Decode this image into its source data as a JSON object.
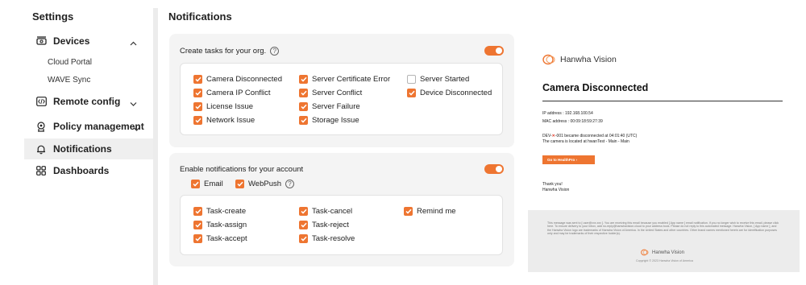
{
  "sidebar": {
    "title": "Settings",
    "devices": {
      "label": "Devices",
      "icon": "router-icon"
    },
    "devices_sub": [
      "Cloud Portal",
      "WAVE Sync"
    ],
    "remote_config": {
      "label": "Remote config",
      "icon": "code-icon"
    },
    "policy": {
      "label": "Policy management",
      "icon": "policy-icon"
    },
    "notifications": {
      "label": "Notifications",
      "icon": "bell-icon"
    },
    "dashboards": {
      "label": "Dashboards",
      "icon": "grid-icon"
    }
  },
  "main": {
    "title": "Notifications",
    "tasks_card": {
      "heading": "Create tasks for your org.",
      "toggle_on": true,
      "items": [
        {
          "label": "Camera Disconnected",
          "checked": true
        },
        {
          "label": "Camera IP Conflict",
          "checked": true
        },
        {
          "label": "License Issue",
          "checked": true
        },
        {
          "label": "Network Issue",
          "checked": true
        },
        {
          "label": "Server Certificate Error",
          "checked": true
        },
        {
          "label": "Server Conflict",
          "checked": true
        },
        {
          "label": "Server Failure",
          "checked": true
        },
        {
          "label": "Storage Issue",
          "checked": true
        },
        {
          "label": "Server Started",
          "checked": false
        },
        {
          "label": "Device Disconnected",
          "checked": true
        }
      ]
    },
    "account_card": {
      "heading": "Enable notifications for your account",
      "toggle_on": true,
      "channels": [
        {
          "label": "Email",
          "checked": true
        },
        {
          "label": "WebPush",
          "checked": true
        }
      ],
      "items": [
        {
          "label": "Task-create",
          "checked": true
        },
        {
          "label": "Task-assign",
          "checked": true
        },
        {
          "label": "Task-accept",
          "checked": true
        },
        {
          "label": "Task-cancel",
          "checked": true
        },
        {
          "label": "Task-reject",
          "checked": true
        },
        {
          "label": "Task-resolve",
          "checked": true
        },
        {
          "label": "Remind me",
          "checked": true
        }
      ]
    }
  },
  "email_preview": {
    "brand": "Hanwha Vision",
    "title": "Camera Disconnected",
    "ip_line": "IP address : 192.168.100.54",
    "mac_line": "MAC address : 00:09:18:59:27:39",
    "event_prefix": "DEV-",
    "event_line": "-001 became disconnected at 04:01:40 (UTC)",
    "location_line": "The camera is located at hwanTest - Main - Main",
    "cta": "Go to HealthPro  ›",
    "thanks": "Thank you!",
    "signature": "Hanwha Vision",
    "footer_text": "This message was sent to [ user@xxx.xxx ]. You are receiving this email because you enabled [ App name ] email notification. If you no longer wish to receive this email, please click here. To ensure delivery to your inbox, add no-reply@hanwhavision.cloud to your address book. Please do not reply to this automated message. Hanwha Vision, [ App name ], and the Hanwha Vision logo are trademarks of Hanwha Vision of America. In the United States and other countries. Other brand names mentioned herein are for identification purposes only and may be trademarks of their respective holder(s).",
    "footer_brand": "Hanwha Vision",
    "copyright": "Copyright © 2023 Hanwha Vision of America",
    "accent": "#ee7531"
  }
}
